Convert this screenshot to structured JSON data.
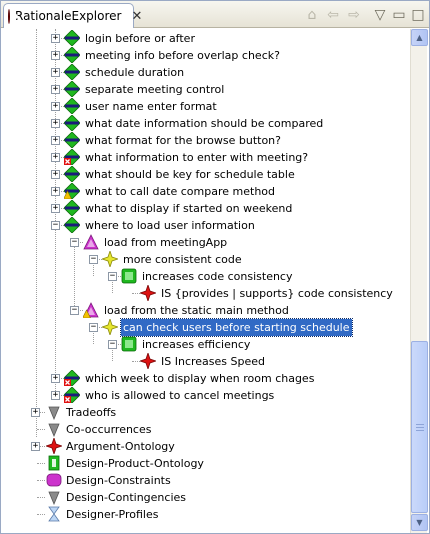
{
  "view": {
    "tab_title": "RationaleExplorer",
    "tab_close": "✕",
    "toolbar": [
      {
        "icon": "home-icon",
        "glyph": "⌂"
      },
      {
        "icon": "back-arrow-icon",
        "glyph": "⇦"
      },
      {
        "icon": "forward-arrow-icon",
        "glyph": "⇨"
      },
      {
        "icon": "view-menu-icon",
        "glyph": "▽"
      },
      {
        "icon": "minimize-icon",
        "glyph": "▭"
      },
      {
        "icon": "maximize-icon",
        "glyph": "□"
      }
    ]
  },
  "tree": {
    "rows": [
      {
        "label": "login before or after",
        "icon": "diamond-green-icon",
        "toggle": "+",
        "depth": 2
      },
      {
        "label": "meeting info before overlap check?",
        "icon": "diamond-green-icon",
        "toggle": "+",
        "depth": 2
      },
      {
        "label": "schedule duration",
        "icon": "diamond-green-icon",
        "toggle": "+",
        "depth": 2
      },
      {
        "label": "separate meeting control",
        "icon": "diamond-green-icon",
        "toggle": "+",
        "depth": 2
      },
      {
        "label": "user name enter format",
        "icon": "diamond-green-icon",
        "toggle": "+",
        "depth": 2
      },
      {
        "label": "what date information should be compared",
        "icon": "diamond-green-icon",
        "toggle": "+",
        "depth": 2
      },
      {
        "label": "what format for the browse button?",
        "icon": "diamond-green-icon",
        "toggle": "+",
        "depth": 2
      },
      {
        "label": "what information to enter with meeting?",
        "icon": "diamond-green-error-icon",
        "toggle": "+",
        "depth": 2
      },
      {
        "label": "what should be key for schedule table",
        "icon": "diamond-green-icon",
        "toggle": "+",
        "depth": 2
      },
      {
        "label": "what to call date compare method",
        "icon": "diamond-green-warning-icon",
        "toggle": "+",
        "depth": 2
      },
      {
        "label": "what to display if started on weekend",
        "icon": "diamond-green-icon",
        "toggle": "+",
        "depth": 2
      },
      {
        "label": "where to load user information",
        "icon": "diamond-green-icon",
        "toggle": "−",
        "depth": 2
      },
      {
        "label": "load from meetingApp",
        "icon": "triangle-magenta-icon",
        "toggle": "−",
        "depth": 3
      },
      {
        "label": "more consistent code",
        "icon": "star-yellow-icon",
        "toggle": "−",
        "depth": 4
      },
      {
        "label": "increases code consistency",
        "icon": "square-green-icon",
        "toggle": "−",
        "depth": 5
      },
      {
        "label": "IS {provides  | supports} code consistency",
        "icon": "cross-red-icon",
        "toggle": "",
        "depth": 6
      },
      {
        "label": "load from the static main method",
        "icon": "triangle-magenta-warning-icon",
        "toggle": "−",
        "depth": 3
      },
      {
        "label": "can check users before starting schedule",
        "icon": "star-yellow-icon",
        "toggle": "−",
        "depth": 4,
        "selected": true
      },
      {
        "label": "increases efficiency",
        "icon": "square-green-icon",
        "toggle": "−",
        "depth": 5
      },
      {
        "label": "IS Increases Speed",
        "icon": "cross-red-icon",
        "toggle": "",
        "depth": 6
      },
      {
        "label": "which week to display when room chages",
        "icon": "diamond-green-error-icon",
        "toggle": "+",
        "depth": 2
      },
      {
        "label": "who is allowed to cancel meetings",
        "icon": "diamond-green-error-icon",
        "toggle": "+",
        "depth": 2
      },
      {
        "label": "Tradeoffs",
        "icon": "funnel-gray-icon",
        "toggle": "+",
        "depth": 0
      },
      {
        "label": "Co-occurrences",
        "icon": "funnel-gray-icon",
        "toggle": "",
        "depth": 0
      },
      {
        "label": "Argument-Ontology",
        "icon": "cross-red-icon",
        "toggle": "+",
        "depth": 0
      },
      {
        "label": "Design-Product-Ontology",
        "icon": "product-green-icon",
        "toggle": "",
        "depth": 0
      },
      {
        "label": "Design-Constraints",
        "icon": "rounded-magenta-icon",
        "toggle": "",
        "depth": 0
      },
      {
        "label": "Design-Contingencies",
        "icon": "funnel-gray-icon",
        "toggle": "",
        "depth": 0
      },
      {
        "label": "Designer-Profiles",
        "icon": "hourglass-blue-icon",
        "toggle": "",
        "depth": 0
      }
    ]
  },
  "scrollbar": {
    "up_arrow": "▲",
    "down_arrow": "▼",
    "position_fraction": 0.62
  },
  "colors": {
    "selection": "#316ac5",
    "diamond_green": "#1fb81f",
    "diamond_bar": "#1b1b7a",
    "magenta": "#cc33cc",
    "yellow": "#e6e62e",
    "red": "#dd1111"
  }
}
